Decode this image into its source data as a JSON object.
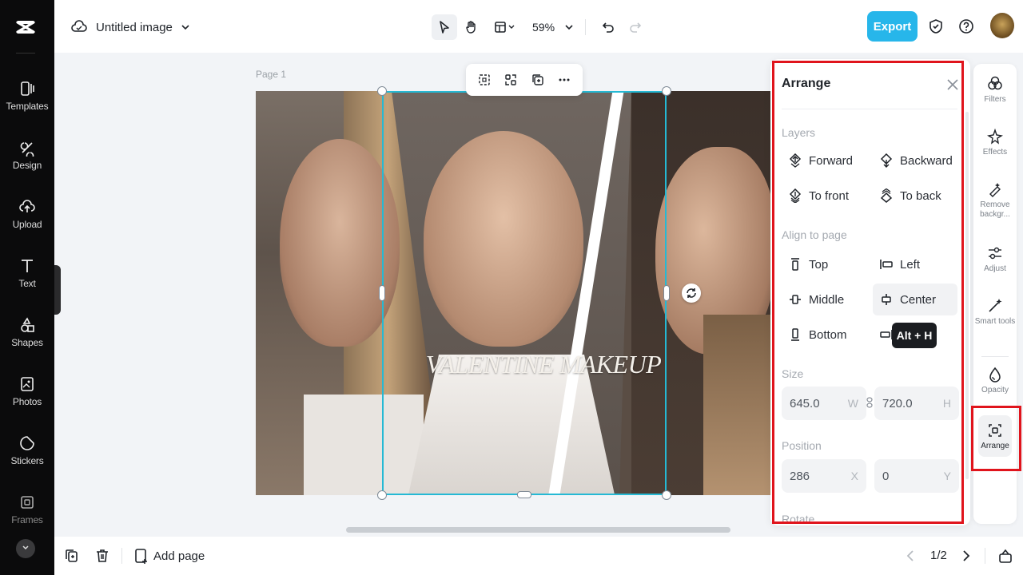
{
  "app": {
    "logo": "CapCut"
  },
  "sidebar": {
    "items": [
      {
        "label": "Templates",
        "icon": "templates-icon"
      },
      {
        "label": "Design",
        "icon": "design-icon"
      },
      {
        "label": "Upload",
        "icon": "upload-icon"
      },
      {
        "label": "Text",
        "icon": "text-icon"
      },
      {
        "label": "Shapes",
        "icon": "shapes-icon"
      },
      {
        "label": "Photos",
        "icon": "photos-icon"
      },
      {
        "label": "Stickers",
        "icon": "stickers-icon"
      },
      {
        "label": "Frames",
        "icon": "frames-icon"
      }
    ]
  },
  "header": {
    "title": "Untitled image",
    "zoom": "59%",
    "export_label": "Export"
  },
  "canvas": {
    "page_label": "Page 1",
    "overlay_text": "VALENTINE MAKEUP"
  },
  "bottom": {
    "add_page_label": "Add page",
    "pager": "1/2"
  },
  "arrange": {
    "title": "Arrange",
    "layers_heading": "Layers",
    "forward": "Forward",
    "backward": "Backward",
    "to_front": "To front",
    "to_back": "To back",
    "align_heading": "Align to page",
    "top": "Top",
    "left": "Left",
    "middle": "Middle",
    "center": "Center",
    "bottom": "Bottom",
    "tooltip": "Alt + H",
    "size_heading": "Size",
    "width": "645.0",
    "width_unit": "W",
    "height": "720.0",
    "height_unit": "H",
    "position_heading": "Position",
    "pos_x": "286",
    "pos_x_unit": "X",
    "pos_y": "0",
    "pos_y_unit": "Y",
    "rotate_heading": "Rotate"
  },
  "rail": {
    "items": [
      {
        "label": "Filters"
      },
      {
        "label": "Effects"
      },
      {
        "label": "Remove backgr..."
      },
      {
        "label": "Adjust"
      },
      {
        "label": "Smart tools"
      },
      {
        "label": "Opacity"
      },
      {
        "label": "Arrange"
      }
    ]
  },
  "colors": {
    "accent": "#27b6ea",
    "selection": "#25b9d4",
    "highlight_box": "#e0141c",
    "sidebar_bg": "#0b0b0c"
  }
}
